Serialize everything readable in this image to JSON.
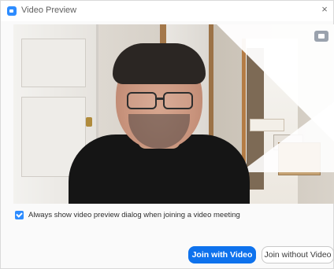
{
  "window": {
    "title": "Video Preview",
    "close_glyph": "×",
    "app_icon": "zoom-camera-icon"
  },
  "video": {
    "toggle_icon": "video-icon"
  },
  "options": {
    "always_show_label": "Always show video preview dialog when joining a video meeting",
    "always_show_checked": true
  },
  "actions": {
    "join_with_video": "Join with Video",
    "join_without_video": "Join without Video"
  },
  "colors": {
    "accent": "#0e72ed",
    "checkbox": "#2d8cff"
  }
}
